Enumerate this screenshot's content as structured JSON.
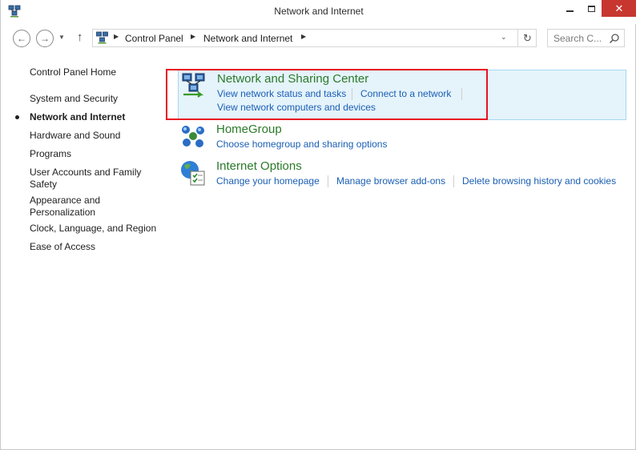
{
  "window": {
    "title": "Network and Internet",
    "close_glyph": "✕"
  },
  "navigation": {
    "back_icon": "back-arrow-icon",
    "forward_icon": "forward-arrow-icon",
    "up_icon": "up-arrow-icon"
  },
  "address": {
    "breadcrumbs": [
      "Control Panel",
      "Network and Internet"
    ],
    "search_placeholder": "Search C..."
  },
  "sidebar": {
    "items": [
      {
        "label": "Control Panel Home",
        "current": false
      },
      {
        "label": "System and Security",
        "current": false
      },
      {
        "label": "Network and Internet",
        "current": true
      },
      {
        "label": "Hardware and Sound",
        "current": false
      },
      {
        "label": "Programs",
        "current": false
      },
      {
        "label": "User Accounts and Family Safety",
        "current": false
      },
      {
        "label": "Appearance and Personalization",
        "current": false
      },
      {
        "label": "Clock, Language, and Region",
        "current": false
      },
      {
        "label": "Ease of Access",
        "current": false
      }
    ]
  },
  "categories": [
    {
      "title": "Network and Sharing Center",
      "icon": "network-sharing-center-icon",
      "highlighted": true,
      "links": [
        "View network status and tasks",
        "Connect to a network",
        "View network computers and devices"
      ]
    },
    {
      "title": "HomeGroup",
      "icon": "homegroup-icon",
      "highlighted": false,
      "links": [
        "Choose homegroup and sharing options"
      ]
    },
    {
      "title": "Internet Options",
      "icon": "internet-options-icon",
      "highlighted": false,
      "links": [
        "Change your homepage",
        "Manage browser add-ons",
        "Delete browsing history and cookies"
      ]
    }
  ],
  "colors": {
    "category_title": "#2a7a2a",
    "link": "#1a5fb4",
    "highlight_bg": "#e5f3fb",
    "annotation_box": "#e81123",
    "close_button": "#c7372f"
  }
}
